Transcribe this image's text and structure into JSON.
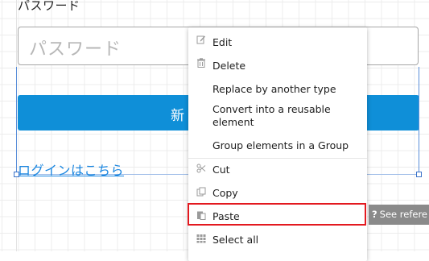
{
  "canvas": {
    "password_label": "パスワード",
    "password_placeholder": "パスワード",
    "submit_button_partial": "新",
    "login_link": "ログインはこちら"
  },
  "context_menu": {
    "items": [
      {
        "label": "Edit",
        "icon": "edit-icon"
      },
      {
        "label": "Delete",
        "icon": "trash-icon"
      },
      {
        "label": "Replace by another type",
        "icon": ""
      },
      {
        "label": "Convert into a reusable\nelement",
        "icon": ""
      },
      {
        "label": "Group elements in a Group",
        "icon": ""
      },
      {
        "label": "Cut",
        "icon": "scissors-icon"
      },
      {
        "label": "Copy",
        "icon": "copy-icon"
      },
      {
        "label": "Paste",
        "icon": "paste-icon"
      },
      {
        "label": "Select all",
        "icon": "grid-icon"
      }
    ],
    "highlighted_item": "Paste"
  },
  "tooltip": {
    "icon": "question-icon",
    "text": "See refere"
  },
  "colors": {
    "button_blue": "#0f8fd8",
    "link_blue": "#1a86e0",
    "highlight_red": "#e3191f",
    "tooltip_gray": "#8a8a8a"
  }
}
